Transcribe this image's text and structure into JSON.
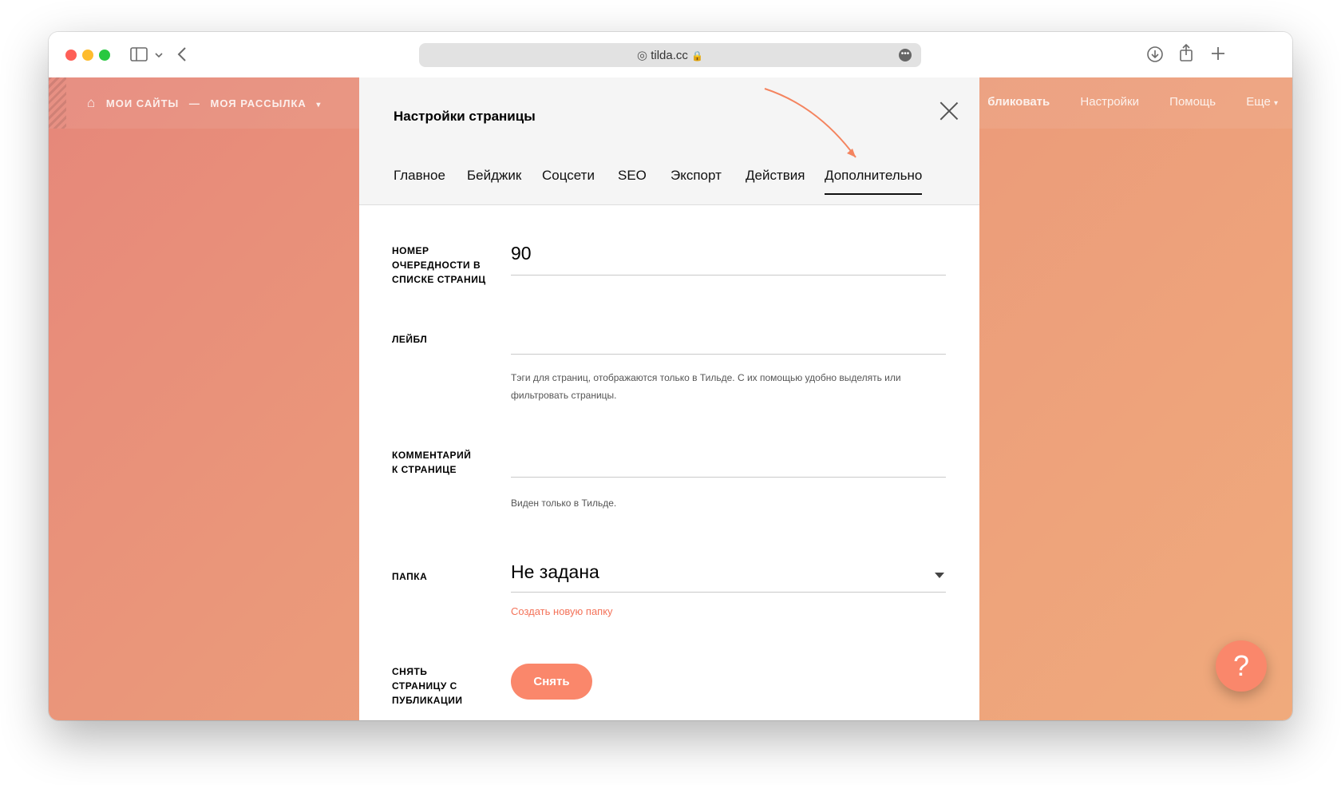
{
  "browser": {
    "url": "tilda.cc"
  },
  "app": {
    "breadcrumb": {
      "my_sites": "МОИ САЙТЫ",
      "separator": "—",
      "project": "МОЯ РАССЫЛКА"
    },
    "menu": {
      "publish": "бликовать",
      "settings": "Настройки",
      "help": "Помощь",
      "more": "Еще"
    },
    "help_button": "?"
  },
  "modal": {
    "title": "Настройки страницы",
    "tabs": [
      "Главное",
      "Бейджик",
      "Соцсети",
      "SEO",
      "Экспорт",
      "Действия",
      "Дополнительно"
    ],
    "active_tab": "Дополнительно",
    "fields": {
      "order": {
        "label": "НОМЕР ОЧЕРЕДНОСТИ В СПИСКЕ СТРАНИЦ",
        "value": "90"
      },
      "label_field": {
        "label": "ЛЕЙБЛ",
        "value": "",
        "hint": "Тэги для страниц, отображаются только в Тильде. С их помощью удобно выделять или фильтровать страницы."
      },
      "comment": {
        "label": "КОММЕНТАРИЙ К СТРАНИЦЕ",
        "value": "",
        "hint": "Виден только в Тильде."
      },
      "folder": {
        "label": "ПАПКА",
        "value": "Не задана",
        "create_link": "Создать новую папку"
      },
      "unpublish": {
        "label": "СНЯТЬ СТРАНИЦУ С ПУБЛИКАЦИИ",
        "button": "Снять"
      }
    }
  },
  "colors": {
    "accent": "#fa876b",
    "link": "#f4735a",
    "annotation_arrow": "#f4845f"
  }
}
